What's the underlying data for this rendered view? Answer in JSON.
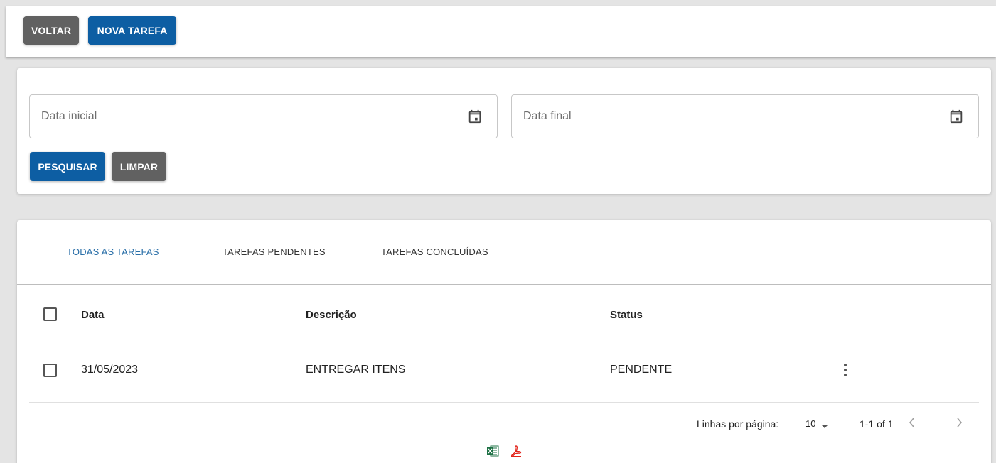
{
  "toolbar": {
    "back_label": "VOLTAR",
    "new_task_label": "NOVA TAREFA"
  },
  "filters": {
    "start_date_placeholder": "Data inicial",
    "end_date_placeholder": "Data final",
    "calendar_icon": "calendar-icon",
    "search_label": "PESQUISAR",
    "clear_label": "LIMPAR"
  },
  "tabs": [
    {
      "label": "TODAS AS TAREFAS",
      "active": true
    },
    {
      "label": "TAREFAS PENDENTES",
      "active": false
    },
    {
      "label": "TAREFAS CONCLUÍDAS",
      "active": false
    }
  ],
  "table": {
    "columns": [
      "Data",
      "Descrição",
      "Status"
    ],
    "rows": [
      {
        "date": "31/05/2023",
        "description": "ENTREGAR ITENS",
        "status": "PENDENTE",
        "checked": false
      }
    ]
  },
  "pagination": {
    "rows_per_page_label": "Linhas por página:",
    "rows_per_page_value": "10",
    "range_text": "1-1 of 1"
  },
  "export": {
    "excel_icon": "excel-icon",
    "pdf_icon": "pdf-icon"
  },
  "colors": {
    "primary": "#0d5ea3",
    "secondary": "#616161",
    "tab_active": "#2a6fa8",
    "excel_green": "#1e7145",
    "pdf_red": "#e2231a"
  }
}
